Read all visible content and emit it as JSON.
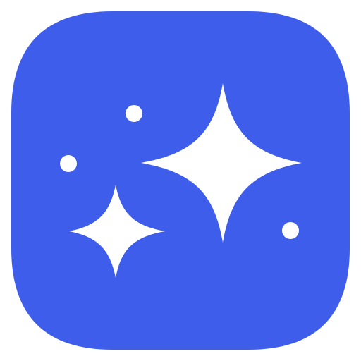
{
  "icon": {
    "name": "sparkles-app-icon",
    "background_color": "#3e5deb",
    "glyph_color": "#ffffff",
    "glyph": "sparkles-icon",
    "elements": [
      "large-four-point-star",
      "small-four-point-star",
      "dot",
      "dot",
      "dot"
    ]
  }
}
